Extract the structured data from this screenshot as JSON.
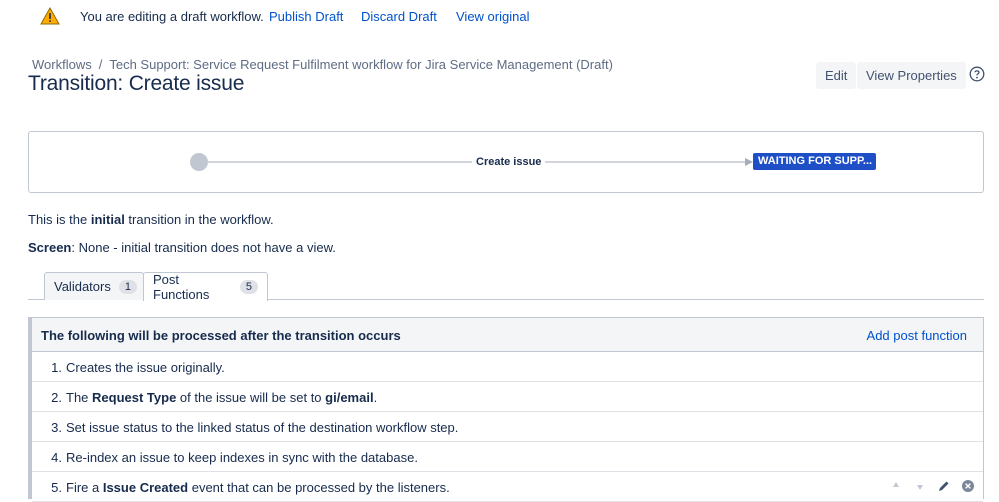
{
  "banner": {
    "message": "You are editing a draft workflow.",
    "publish_label": "Publish Draft",
    "discard_label": "Discard Draft",
    "view_original_label": "View original",
    "icon": "warning-icon"
  },
  "breadcrumb": {
    "root": "Workflows",
    "separator": "/",
    "workflow": "Tech Support: Service Request Fulfilment workflow for Jira Service Management (Draft)"
  },
  "page": {
    "title": "Transition: Create issue"
  },
  "header_actions": {
    "edit_label": "Edit",
    "view_properties_label": "View Properties",
    "help_icon": "help-icon"
  },
  "diagram": {
    "transition_label": "Create issue",
    "destination_status": "WAITING FOR SUPP...",
    "status_color": "#1f4fc6"
  },
  "info": {
    "initial_prefix": "This is the ",
    "initial_bold": "initial",
    "initial_suffix": " transition in the workflow.",
    "screen_label": "Screen",
    "screen_value": ": None - initial transition does not have a view."
  },
  "tabs": [
    {
      "label": "Validators",
      "count": "1"
    },
    {
      "label": "Post Functions",
      "count": "5"
    }
  ],
  "post_functions": {
    "header": "The following will be processed after the transition occurs",
    "add_label": "Add post function",
    "items": [
      {
        "num": "1.",
        "parts": [
          "Creates the issue originally."
        ]
      },
      {
        "num": "2.",
        "parts": [
          "The ",
          "Request Type",
          " of the issue will be set to ",
          "gi/email",
          "."
        ]
      },
      {
        "num": "3.",
        "parts": [
          "Set issue status to the linked status of the destination workflow step."
        ]
      },
      {
        "num": "4.",
        "parts": [
          "Re-index an issue to keep indexes in sync with the database."
        ]
      },
      {
        "num": "5.",
        "parts": [
          "Fire a ",
          "Issue Created",
          " event that can be processed by the listeners."
        ]
      }
    ]
  }
}
